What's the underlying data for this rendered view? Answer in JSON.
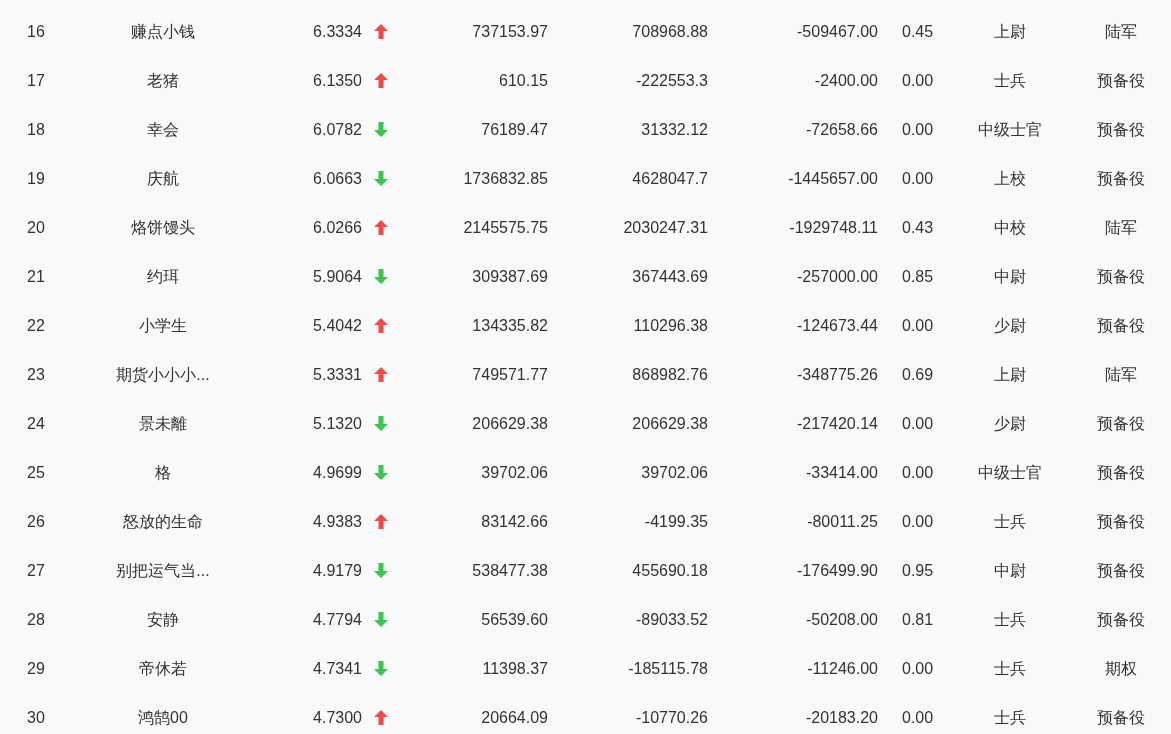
{
  "rows": [
    {
      "rank": "16",
      "name": "赚点小钱",
      "score": "6.3334",
      "kind": "up",
      "col4": "737153.97",
      "col5": "708968.88",
      "col6": "-509467.00",
      "col7": "0.45",
      "rank_title": "上尉",
      "col9": "陆军"
    },
    {
      "rank": "17",
      "name": "老猪",
      "score": "6.1350",
      "kind": "up",
      "col4": "610.15",
      "col5": "-222553.3",
      "col6": "-2400.00",
      "col7": "0.00",
      "rank_title": "士兵",
      "col9": "预备役"
    },
    {
      "rank": "18",
      "name": "幸会",
      "score": "6.0782",
      "kind": "down",
      "col4": "76189.47",
      "col5": "31332.12",
      "col6": "-72658.66",
      "col7": "0.00",
      "rank_title": "中级士官",
      "col9": "预备役"
    },
    {
      "rank": "19",
      "name": "庆航",
      "score": "6.0663",
      "kind": "down",
      "col4": "1736832.85",
      "col5": "4628047.7",
      "col6": "-1445657.00",
      "col7": "0.00",
      "rank_title": "上校",
      "col9": "预备役"
    },
    {
      "rank": "20",
      "name": "烙饼馒头",
      "score": "6.0266",
      "kind": "up",
      "col4": "2145575.75",
      "col5": "2030247.31",
      "col6": "-1929748.11",
      "col7": "0.43",
      "rank_title": "中校",
      "col9": "陆军"
    },
    {
      "rank": "21",
      "name": "约珥",
      "score": "5.9064",
      "kind": "down",
      "col4": "309387.69",
      "col5": "367443.69",
      "col6": "-257000.00",
      "col7": "0.85",
      "rank_title": "中尉",
      "col9": "预备役"
    },
    {
      "rank": "22",
      "name": "小学生",
      "score": "5.4042",
      "kind": "up",
      "col4": "134335.82",
      "col5": "110296.38",
      "col6": "-124673.44",
      "col7": "0.00",
      "rank_title": "少尉",
      "col9": "预备役"
    },
    {
      "rank": "23",
      "name": "期货小小小...",
      "score": "5.3331",
      "kind": "up",
      "col4": "749571.77",
      "col5": "868982.76",
      "col6": "-348775.26",
      "col7": "0.69",
      "rank_title": "上尉",
      "col9": "陆军"
    },
    {
      "rank": "24",
      "name": "景未離",
      "score": "5.1320",
      "kind": "down",
      "col4": "206629.38",
      "col5": "206629.38",
      "col6": "-217420.14",
      "col7": "0.00",
      "rank_title": "少尉",
      "col9": "预备役"
    },
    {
      "rank": "25",
      "name": "格",
      "score": "4.9699",
      "kind": "down",
      "col4": "39702.06",
      "col5": "39702.06",
      "col6": "-33414.00",
      "col7": "0.00",
      "rank_title": "中级士官",
      "col9": "预备役"
    },
    {
      "rank": "26",
      "name": "怒放的生命",
      "score": "4.9383",
      "kind": "up",
      "col4": "83142.66",
      "col5": "-4199.35",
      "col6": "-80011.25",
      "col7": "0.00",
      "rank_title": "士兵",
      "col9": "预备役"
    },
    {
      "rank": "27",
      "name": "别把运气当...",
      "score": "4.9179",
      "kind": "down",
      "col4": "538477.38",
      "col5": "455690.18",
      "col6": "-176499.90",
      "col7": "0.95",
      "rank_title": "中尉",
      "col9": "预备役"
    },
    {
      "rank": "28",
      "name": "安静",
      "score": "4.7794",
      "kind": "down",
      "col4": "56539.60",
      "col5": "-89033.52",
      "col6": "-50208.00",
      "col7": "0.81",
      "rank_title": "士兵",
      "col9": "预备役"
    },
    {
      "rank": "29",
      "name": "帝休若",
      "score": "4.7341",
      "kind": "down",
      "col4": "11398.37",
      "col5": "-185115.78",
      "col6": "-11246.00",
      "col7": "0.00",
      "rank_title": "士兵",
      "col9": "期权"
    },
    {
      "rank": "30",
      "name": "鸿鹄00",
      "score": "4.7300",
      "kind": "up",
      "col4": "20664.09",
      "col5": "-10770.26",
      "col6": "-20183.20",
      "col7": "0.00",
      "rank_title": "士兵",
      "col9": "预备役"
    }
  ]
}
